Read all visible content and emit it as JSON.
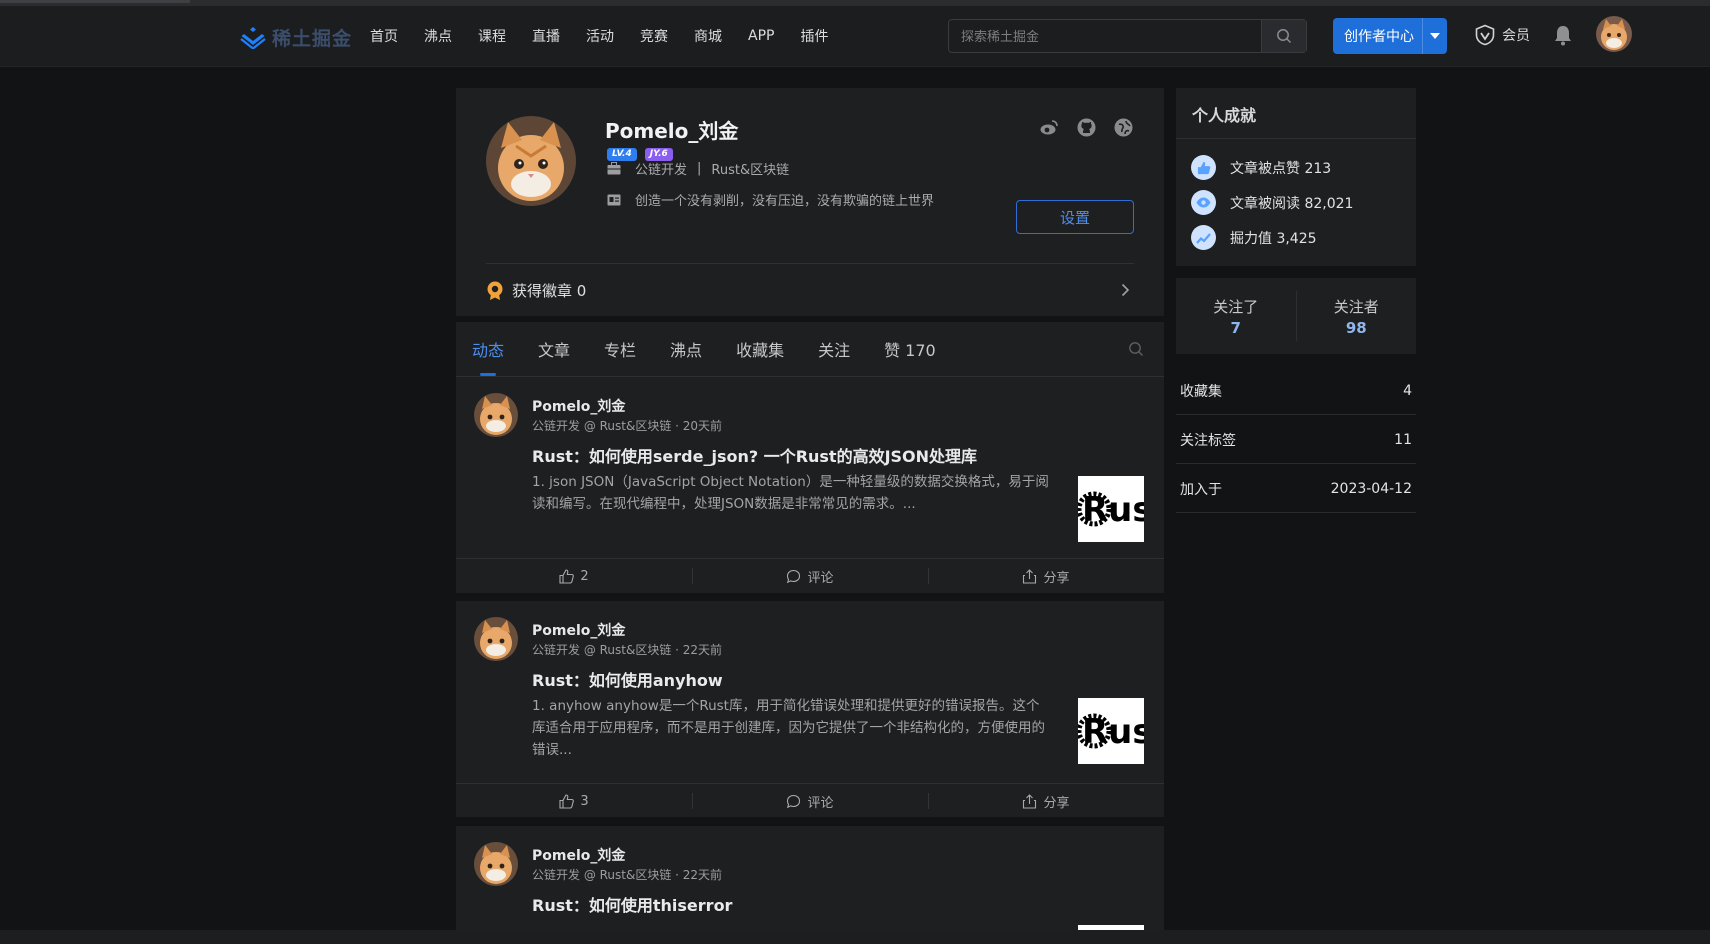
{
  "header": {
    "logo_text": "稀土掘金",
    "nav": [
      "首页",
      "沸点",
      "课程",
      "直播",
      "活动",
      "竞赛",
      "商城",
      "APP",
      "插件"
    ],
    "search_placeholder": "探索稀土掘金",
    "creator_label": "创作者中心",
    "vip_label": "会员"
  },
  "profile": {
    "name": "Pomelo_刘金",
    "badge_level": "LV.4",
    "badge_jy": "JY.6",
    "job": "公链开发",
    "company": "Rust&区块链",
    "separator": "|",
    "bio": "创造一个没有剥削，没有压迫，没有欺骗的链上世界",
    "settings_label": "设置",
    "medals_label": "获得徽章 0"
  },
  "tabs": [
    "动态",
    "文章",
    "专栏",
    "沸点",
    "收藏集",
    "关注",
    "赞 170"
  ],
  "feed": [
    {
      "author": "Pomelo_刘金",
      "meta": "公链开发 @ Rust&区块链 · 20天前",
      "title": "Rust：如何使用serde_json? 一个Rust的高效JSON处理库",
      "desc": "1. json JSON（JavaScript Object Notation）是一种轻量级的数据交换格式，易于阅读和编写。在现代编程中，处理JSON数据是非常常见的需求。...",
      "thumb_text": "Rus",
      "likes": "2",
      "comment_label": "评论",
      "share_label": "分享"
    },
    {
      "author": "Pomelo_刘金",
      "meta": "公链开发 @ Rust&区块链 · 22天前",
      "title": "Rust：如何使用anyhow",
      "desc": "1. anyhow anyhow是一个Rust库，用于简化错误处理和提供更好的错误报告。这个库适合用于应用程序，而不是用于创建库，因为它提供了一个非结构化的，方便使用的错误...",
      "thumb_text": "Rus",
      "likes": "3",
      "comment_label": "评论",
      "share_label": "分享"
    },
    {
      "author": "Pomelo_刘金",
      "meta": "公链开发 @ Rust&区块链 · 22天前",
      "title": "Rust：如何使用thiserror"
    }
  ],
  "sidebar": {
    "achievements_title": "个人成就",
    "achievements": [
      {
        "label": "文章被点赞 213"
      },
      {
        "label": "文章被阅读 82,021"
      },
      {
        "label": "掘力值 3,425"
      }
    ],
    "following_label": "关注了",
    "following_count": "7",
    "followers_label": "关注者",
    "followers_count": "98",
    "rows": [
      {
        "label": "收藏集",
        "value": "4"
      },
      {
        "label": "关注标签",
        "value": "11"
      },
      {
        "label": "加入于",
        "value": "2023-04-12"
      }
    ]
  },
  "colors": {
    "accent": "#1e6fd9",
    "background": "#121314",
    "card": "#1e1f21"
  }
}
